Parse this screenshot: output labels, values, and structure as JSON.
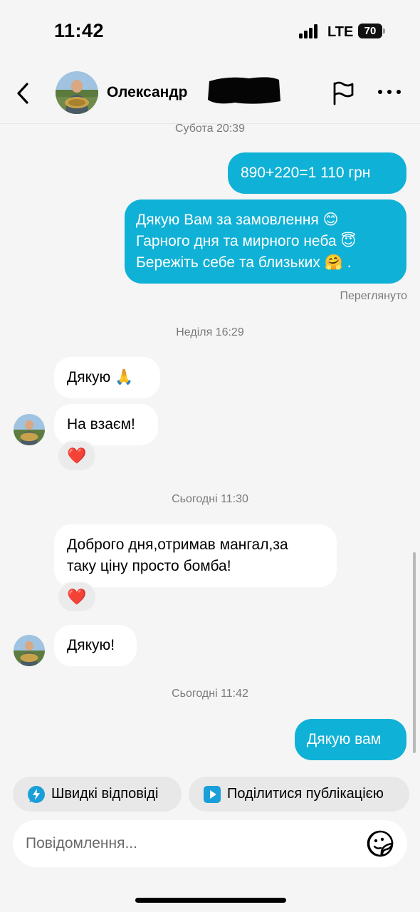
{
  "status_bar": {
    "time": "11:42",
    "network": "LTE",
    "battery": "70"
  },
  "header": {
    "contact_name": "Олександр",
    "back_icon": "chevron-left-icon",
    "flag_icon": "flag-icon",
    "more_icon": "more-horizontal-icon"
  },
  "messages": [
    {
      "timestamp": "Субота 20:39"
    },
    {
      "direction": "out",
      "text": "890+220=1 110 грн"
    },
    {
      "direction": "out",
      "lines": [
        "Дякую Вам за замовлення 😊",
        "Гарного дня та мирного неба 😇",
        "Бережіть себе та близьких 🤗 ."
      ]
    },
    {
      "status": "Переглянуто"
    },
    {
      "timestamp": "Неділя 16:29"
    },
    {
      "direction": "in",
      "text": "Дякую 🙏"
    },
    {
      "direction": "in",
      "text": "На взаєм!",
      "reaction": "❤️"
    },
    {
      "timestamp": "Сьогодні 11:30"
    },
    {
      "direction": "in",
      "lines": [
        "Доброго дня,отримав мангал,за",
        "таку ціну просто бомба!"
      ],
      "reaction": "❤️"
    },
    {
      "direction": "in",
      "text": "Дякую!"
    },
    {
      "timestamp": "Сьогодні 11:42"
    },
    {
      "direction": "out",
      "text": "Дякую вам"
    }
  ],
  "quick_actions": [
    {
      "label": "Швидкі відповіді",
      "icon": "lightning-bubble-icon"
    },
    {
      "label": "Поділитися публікацією",
      "icon": "share-post-icon"
    }
  ],
  "composer": {
    "placeholder": "Повідомлення...",
    "sticker_icon": "sticker-icon"
  },
  "colors": {
    "outgoing_bubble": "#10b1d6",
    "incoming_bubble": "#ffffff",
    "background": "#f5f5f5",
    "reaction_heart": "#e8132f"
  }
}
